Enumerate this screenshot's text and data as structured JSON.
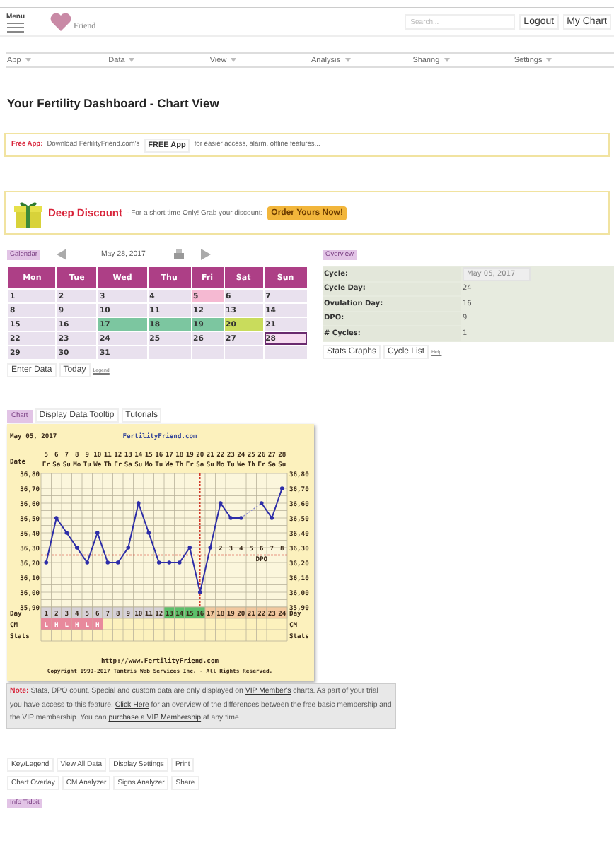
{
  "header": {
    "menu_label": "Menu",
    "logo_text": "Friend",
    "search": {
      "placeholder": "Search..."
    },
    "buttons": [
      "Logout",
      "My Chart"
    ]
  },
  "nav": [
    "App",
    "Data",
    "View",
    "Analysis",
    "Sharing",
    "Settings"
  ],
  "title": "Your Fertility Dashboard - Chart View",
  "free_app": {
    "label": "Free App:",
    "text_before": "Download FertilityFriend.com's",
    "button": "FREE App",
    "text_after": "for easier access, alarm, offline features..."
  },
  "discount": {
    "label": "Deep Discount",
    "text": "- For a short time Only! Grab your discount:",
    "button": "Order Yours Now!"
  },
  "calendar": {
    "tag": "Calendar",
    "date": "May 28, 2017",
    "weekdays": [
      "Mon",
      "Tue",
      "Wed",
      "Thu",
      "Fri",
      "Sat",
      "Sun"
    ],
    "days": [
      {
        "label": "1",
        "color": "#e9e1ee",
        "selected": false
      },
      {
        "label": "2",
        "color": "#e9e1ee",
        "selected": false
      },
      {
        "label": "3",
        "color": "#e9e1ee",
        "selected": false
      },
      {
        "label": "4",
        "color": "#e9e1ee",
        "selected": false
      },
      {
        "label": "5",
        "color": "#f5b9d2",
        "selected": false
      },
      {
        "label": "6",
        "color": "#e9e1ee",
        "selected": false
      },
      {
        "label": "7",
        "color": "#e9e1ee",
        "selected": false
      },
      {
        "label": "8",
        "color": "#e9e1ee",
        "selected": false
      },
      {
        "label": "9",
        "color": "#e9e1ee",
        "selected": false
      },
      {
        "label": "10",
        "color": "#e9e1ee",
        "selected": false
      },
      {
        "label": "11",
        "color": "#e9e1ee",
        "selected": false
      },
      {
        "label": "12",
        "color": "#e9e1ee",
        "selected": false
      },
      {
        "label": "13",
        "color": "#e9e1ee",
        "selected": false
      },
      {
        "label": "14",
        "color": "#e9e1ee",
        "selected": false
      },
      {
        "label": "15",
        "color": "#e9e1ee",
        "selected": false
      },
      {
        "label": "16",
        "color": "#e9e1ee",
        "selected": false
      },
      {
        "label": "17",
        "color": "#7cc6a0",
        "selected": false
      },
      {
        "label": "18",
        "color": "#7cc6a0",
        "selected": false
      },
      {
        "label": "19",
        "color": "#7cc6a0",
        "selected": false
      },
      {
        "label": "20",
        "color": "#c9dc5c",
        "selected": false
      },
      {
        "label": "21",
        "color": "#e9e1ee",
        "selected": false
      },
      {
        "label": "22",
        "color": "#e9e1ee",
        "selected": false
      },
      {
        "label": "23",
        "color": "#e9e1ee",
        "selected": false
      },
      {
        "label": "24",
        "color": "#e9e1ee",
        "selected": false
      },
      {
        "label": "25",
        "color": "#e9e1ee",
        "selected": false
      },
      {
        "label": "26",
        "color": "#e9e1ee",
        "selected": false
      },
      {
        "label": "27",
        "color": "#e9e1ee",
        "selected": false
      },
      {
        "label": "28",
        "color": "#f6dcf0",
        "selected": true
      },
      {
        "label": "29",
        "color": "#e9e1ee",
        "selected": false
      },
      {
        "label": "30",
        "color": "#e9e1ee",
        "selected": false
      },
      {
        "label": "31",
        "color": "#e9e1ee",
        "selected": false
      }
    ],
    "buttons": [
      "Enter Data",
      "Today"
    ],
    "link": "Legend"
  },
  "overview": {
    "tag": "Overview",
    "rows": [
      {
        "label": "Cycle:",
        "value": "May 05, 2017",
        "kind": "select"
      },
      {
        "label": "Cycle Day:",
        "value": "24",
        "kind": "text"
      },
      {
        "label": "Ovulation Day:",
        "value": "16",
        "kind": "text"
      },
      {
        "label": "DPO:",
        "value": "9",
        "kind": "text"
      },
      {
        "label": "# Cycles:",
        "value": "1",
        "kind": "text"
      }
    ],
    "buttons": [
      "Stats Graphs",
      "Cycle List"
    ],
    "link": "Help"
  },
  "chart_tabs": [
    {
      "label": "Chart",
      "selected": true
    },
    {
      "label": "Display Data Tooltip",
      "selected": false
    },
    {
      "label": "Tutorials",
      "selected": false
    }
  ],
  "chart": {
    "date": "May 05, 2017",
    "site": "FertilityFriend.com",
    "date_label": "Date",
    "dates": [
      "5",
      "6",
      "7",
      "8",
      "9",
      "10",
      "11",
      "12",
      "13",
      "14",
      "15",
      "16",
      "17",
      "18",
      "19",
      "20",
      "21",
      "22",
      "23",
      "24",
      "25",
      "26",
      "27",
      "28"
    ],
    "weekdays": [
      "Fr",
      "Sa",
      "Su",
      "Mo",
      "Tu",
      "We",
      "Th",
      "Fr",
      "Sa",
      "Su",
      "Mo",
      "Tu",
      "We",
      "Th",
      "Fr",
      "Sa",
      "Su",
      "Mo",
      "Tu",
      "We",
      "Th",
      "Fr",
      "Sa",
      "Su"
    ],
    "days": [
      {
        "color": "#d6d1d6"
      },
      {
        "color": "#d6d1d6"
      },
      {
        "color": "#d6d1d6"
      },
      {
        "color": "#d6d1d6"
      },
      {
        "color": "#d6d1d6"
      },
      {
        "color": "#d6d1d6"
      },
      {
        "color": "#d6d1d6"
      },
      {
        "color": "#d6d1d6"
      },
      {
        "color": "#d6d1d6"
      },
      {
        "color": "#d6d1d6"
      },
      {
        "color": "#d6d1d6"
      },
      {
        "color": "#d6d1d6"
      },
      {
        "color": "#5cbf6a"
      },
      {
        "color": "#5cbf6a"
      },
      {
        "color": "#5cbf6a"
      },
      {
        "color": "#5cbf6a"
      },
      {
        "color": "#f2c89f"
      },
      {
        "color": "#f2c89f"
      },
      {
        "color": "#f2c89f"
      },
      {
        "color": "#f2c89f"
      },
      {
        "color": "#f2c89f"
      },
      {
        "color": "#f2c89f"
      },
      {
        "color": "#f2c89f"
      },
      {
        "color": "#f2c89f"
      }
    ],
    "cm": [
      {
        "label": "L",
        "color": "#e8899c"
      },
      {
        "label": "H",
        "color": "#e8899c"
      },
      {
        "label": "L",
        "color": "#e8899c"
      },
      {
        "label": "H",
        "color": "#e8899c"
      },
      {
        "label": "L",
        "color": "#e8899c"
      },
      {
        "label": "H",
        "color": "#e8899c"
      }
    ],
    "row_labels": [
      "Day",
      "CM",
      "Stats"
    ],
    "right_row_labels": [
      "Day",
      "CM",
      "Stats"
    ],
    "url": "http://www.FertilityFriend.com",
    "copyright": "Copyright 1999-2017 Tamtris Web Services Inc. - All Rights Reserved.",
    "chart_data": {
      "type": "line",
      "x": [
        1,
        2,
        3,
        4,
        5,
        6,
        7,
        8,
        9,
        10,
        11,
        12,
        13,
        14,
        15,
        16,
        17,
        18,
        19,
        20,
        21,
        22,
        23,
        24
      ],
      "series": [
        {
          "color": "#2e2ea8",
          "values": [
            36.2,
            36.5,
            36.4,
            36.3,
            36.2,
            36.4,
            36.2,
            36.2,
            36.3,
            36.6,
            36.4,
            36.2,
            36.2,
            36.2,
            36.3,
            36.0,
            36.3,
            36.6,
            36.5,
            36.5,
            null,
            36.6,
            36.5,
            36.7
          ]
        }
      ],
      "ylim": [
        35.9,
        36.8
      ],
      "yticks": [
        {
          "value": 36.8,
          "label": "36,80"
        },
        {
          "value": 36.7,
          "label": "36,70"
        },
        {
          "value": 36.6,
          "label": "36,60"
        },
        {
          "value": 36.5,
          "label": "36,50"
        },
        {
          "value": 36.4,
          "label": "36,40"
        },
        {
          "value": 36.3,
          "label": "36,30"
        },
        {
          "value": 36.2,
          "label": "36,20"
        },
        {
          "value": 36.1,
          "label": "36,10"
        },
        {
          "value": 36.0,
          "label": "36,00"
        },
        {
          "value": 35.9,
          "label": "35,90"
        }
      ],
      "xticks": [
        1,
        2,
        3,
        4,
        5,
        6,
        7,
        8,
        9,
        10,
        11,
        12,
        13,
        14,
        15,
        16,
        17,
        18,
        19,
        20,
        21,
        22,
        23,
        24
      ],
      "grid": true,
      "xlim": [
        0.5,
        24.5
      ],
      "ref_lines": [
        {
          "axis": "y",
          "value": 36.25,
          "color": "#d23a2a"
        },
        {
          "axis": "x",
          "value": 16,
          "color": "#d23a2a"
        }
      ]
    },
    "dpo_labels": [
      "2",
      "3",
      "4",
      "5",
      "6",
      "7",
      "8"
    ],
    "dpo_title": "DPO"
  },
  "note": [
    {
      "kind": "label",
      "text": "Note:"
    },
    {
      "kind": "text",
      "text": " Stats, DPO count, Special and custom data are only displayed on "
    },
    {
      "kind": "link",
      "text": "VIP Member's"
    },
    {
      "kind": "text",
      "text": " charts. As part of your trial you have access to this feature. "
    },
    {
      "kind": "link",
      "text": "Click Here"
    },
    {
      "kind": "text",
      "text": " for an overview of the differences between the free basic membership and the VIP membership. You can "
    },
    {
      "kind": "link",
      "text": "purchase a VIP Membership"
    },
    {
      "kind": "text",
      "text": " at any time."
    }
  ],
  "tool_buttons": [
    [
      "Key/Legend",
      "View All Data",
      "Display Settings",
      "Print"
    ],
    [
      "Chart Overlay",
      "CM Analyzer",
      "Signs Analyzer",
      "Share"
    ]
  ],
  "info_tag": "Info Tidbit"
}
